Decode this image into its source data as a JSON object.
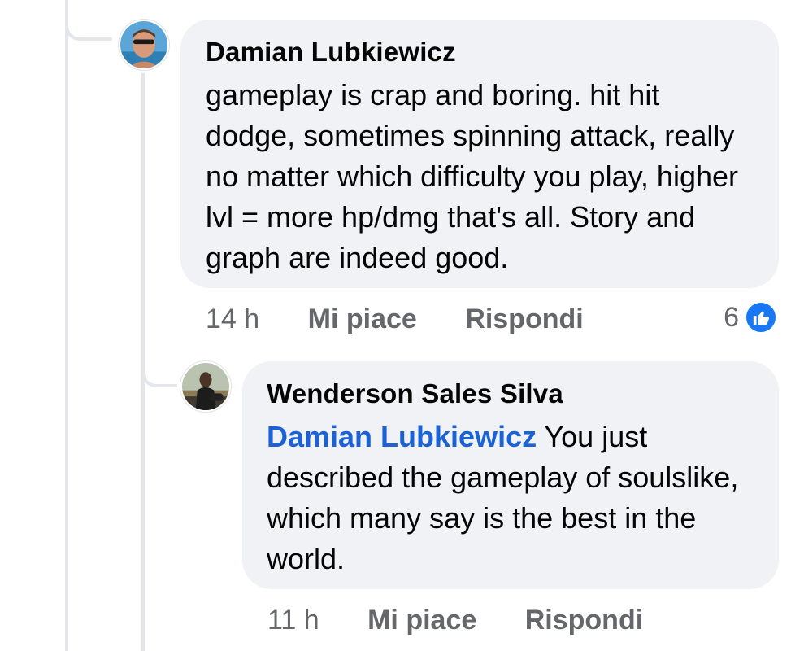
{
  "comment": {
    "author": "Damian Lubkiewicz",
    "text": "gameplay is crap and boring. hit hit dodge, sometimes spinning attack, really no matter which difficulty you play, higher lvl = more hp/dmg that's all. Story and graph are indeed good.",
    "time": "14 h",
    "like_label": "Mi piace",
    "reply_label": "Rispondi",
    "reaction_count": "6",
    "reaction_icon": "like-icon",
    "avatar_icon": "avatar-damian"
  },
  "reply": {
    "author": "Wenderson Sales Silva",
    "mention": "Damian Lubkiewicz",
    "text": " You just described the gameplay of soulslike, which many say is the best in the world.",
    "time": "11 h",
    "like_label": "Mi piace",
    "reply_label": "Rispondi",
    "avatar_icon": "avatar-wenderson"
  },
  "colors": {
    "bubble": "#f0f2f5",
    "mention": "#1b63d4",
    "meta": "#65676b",
    "like": "#1877f2",
    "thread_line": "#e4e6eb"
  }
}
